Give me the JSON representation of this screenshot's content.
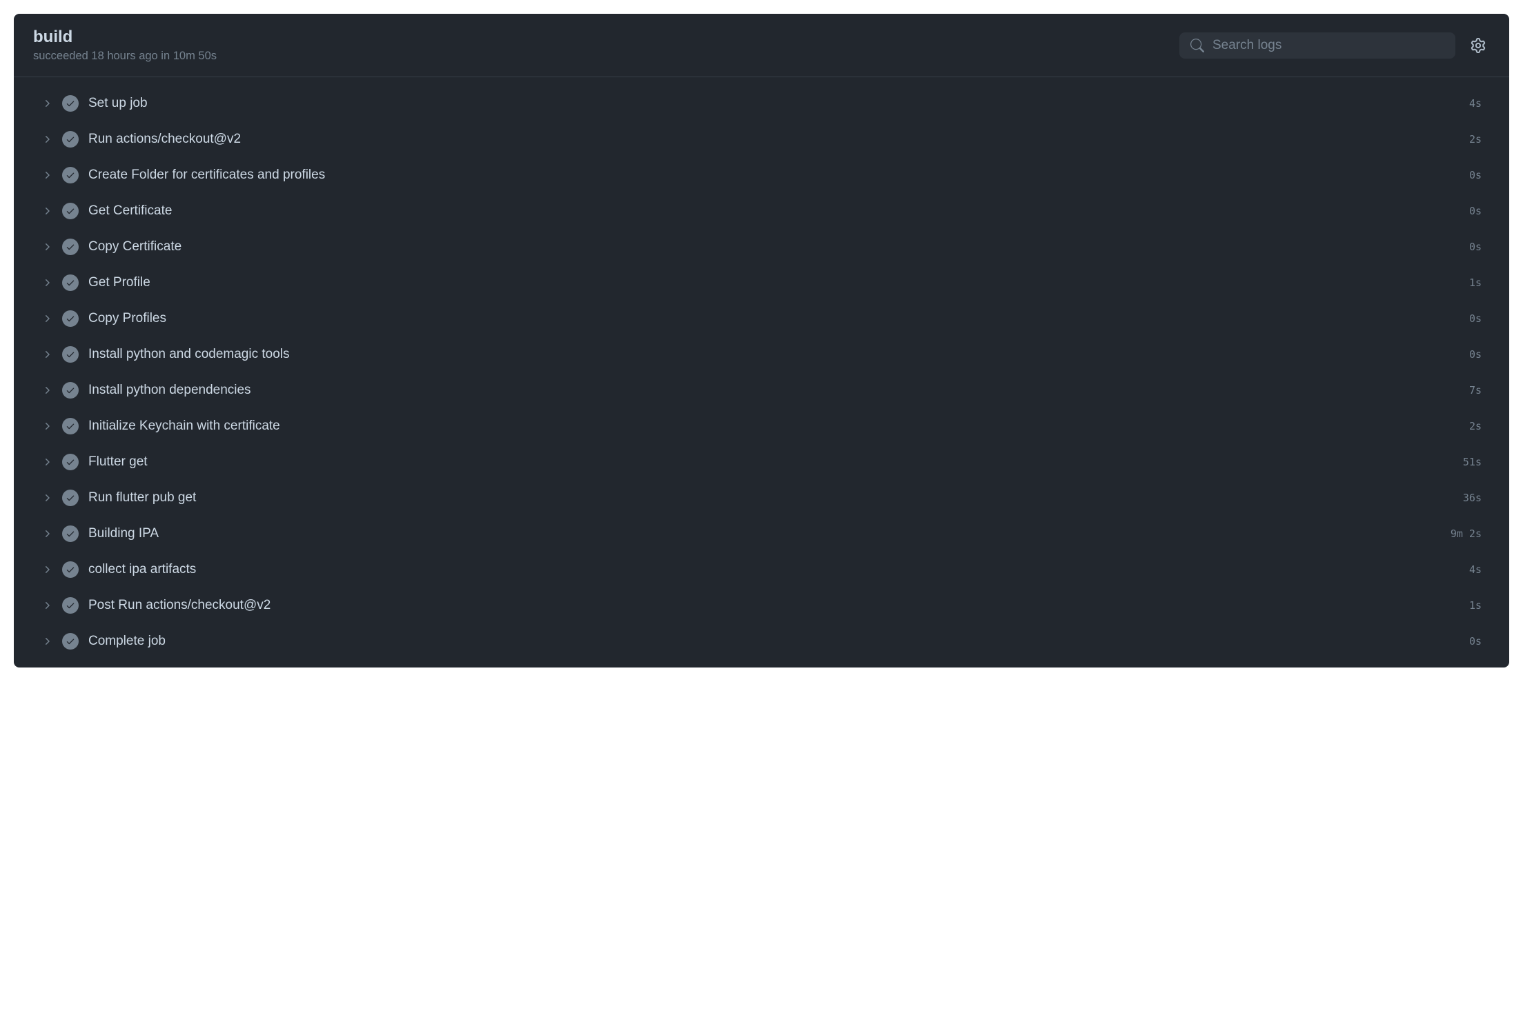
{
  "header": {
    "title": "build",
    "status": "succeeded 18 hours ago in 10m 50s"
  },
  "search": {
    "placeholder": "Search logs"
  },
  "steps": [
    {
      "label": "Set up job",
      "duration": "4s"
    },
    {
      "label": "Run actions/checkout@v2",
      "duration": "2s"
    },
    {
      "label": "Create Folder for certificates and profiles",
      "duration": "0s"
    },
    {
      "label": "Get Certificate",
      "duration": "0s"
    },
    {
      "label": "Copy Certificate",
      "duration": "0s"
    },
    {
      "label": "Get Profile",
      "duration": "1s"
    },
    {
      "label": "Copy Profiles",
      "duration": "0s"
    },
    {
      "label": "Install python and codemagic tools",
      "duration": "0s"
    },
    {
      "label": "Install python dependencies",
      "duration": "7s"
    },
    {
      "label": "Initialize Keychain with certificate",
      "duration": "2s"
    },
    {
      "label": "Flutter get",
      "duration": "51s"
    },
    {
      "label": "Run flutter pub get",
      "duration": "36s"
    },
    {
      "label": "Building IPA",
      "duration": "9m 2s"
    },
    {
      "label": "collect ipa artifacts",
      "duration": "4s"
    },
    {
      "label": "Post Run actions/checkout@v2",
      "duration": "1s"
    },
    {
      "label": "Complete job",
      "duration": "0s"
    }
  ]
}
